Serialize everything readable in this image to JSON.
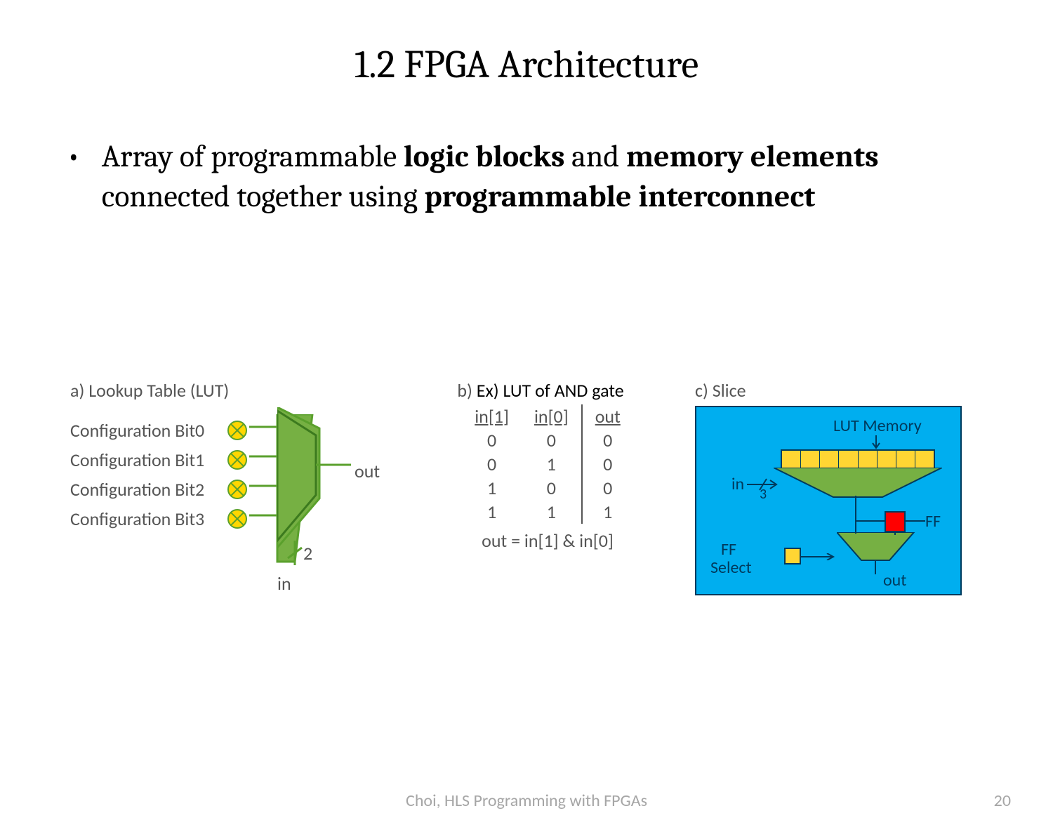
{
  "title": "1.2 FPGA Architecture",
  "bullet": {
    "t1": "Array of programmable ",
    "b1": "logic blocks",
    "t2": " and ",
    "b2": "memory elements",
    "t3": " connected together using ",
    "b3": "programmable interconnect"
  },
  "partA": {
    "header": "a) Lookup Table (LUT)",
    "rows": [
      "Configuration Bit0",
      "Configuration Bit1",
      "Configuration Bit2",
      "Configuration Bit3"
    ],
    "in_width": "2",
    "in_label": "in",
    "out_label": "out"
  },
  "partB": {
    "prefix": "b)",
    "header": "Ex) LUT of AND gate",
    "cols": [
      "in[1]",
      "in[0]",
      "out"
    ],
    "rows": [
      [
        "0",
        "0",
        "0"
      ],
      [
        "0",
        "1",
        "0"
      ],
      [
        "1",
        "0",
        "0"
      ],
      [
        "1",
        "1",
        "1"
      ]
    ],
    "equation": "out = in[1] & in[0]"
  },
  "partC": {
    "header": "c)  Slice",
    "lut_mem": "LUT Memory",
    "in": "in",
    "in_width": "3",
    "ff": "FF",
    "ff_select1": "FF",
    "ff_select2": "Select",
    "out": "out"
  },
  "footer": {
    "citation": "Choi, HLS Programming with FPGAs",
    "page": "20"
  }
}
